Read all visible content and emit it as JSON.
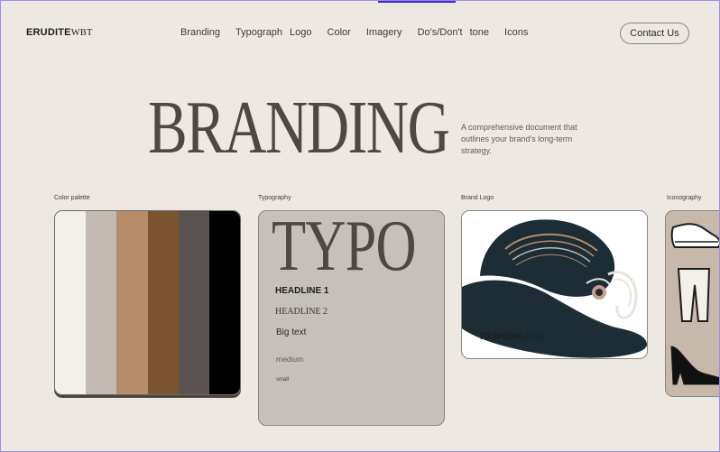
{
  "header": {
    "logo_bold": "ERUDITE",
    "logo_light": "WBT",
    "nav": [
      "Branding",
      "Typograph",
      "Logo",
      "Color",
      "Imagery",
      "Do's/Don't",
      "tone",
      "Icons"
    ],
    "contact_label": "Contact Us"
  },
  "hero": {
    "title": "BRANDING",
    "description": "A comprehensive document that outlines your brand's long-term strategy."
  },
  "sections": {
    "palette_label": "Color palette",
    "typography_label": "Typography",
    "logo_label": "Brand Logo",
    "icons_label": "Iconography"
  },
  "palette": [
    "#f3efea",
    "#c4bab4",
    "#b88b6b",
    "#7a5530",
    "#585250",
    "#000000"
  ],
  "typography": {
    "sample": "TYPO",
    "headline1": "HEADLINE 1",
    "headline2": "HEADLINE 2",
    "big": "Big text",
    "medium": "medium",
    "small": "small"
  },
  "logo": {
    "bold": "FASHION",
    "light": "LOGO"
  }
}
